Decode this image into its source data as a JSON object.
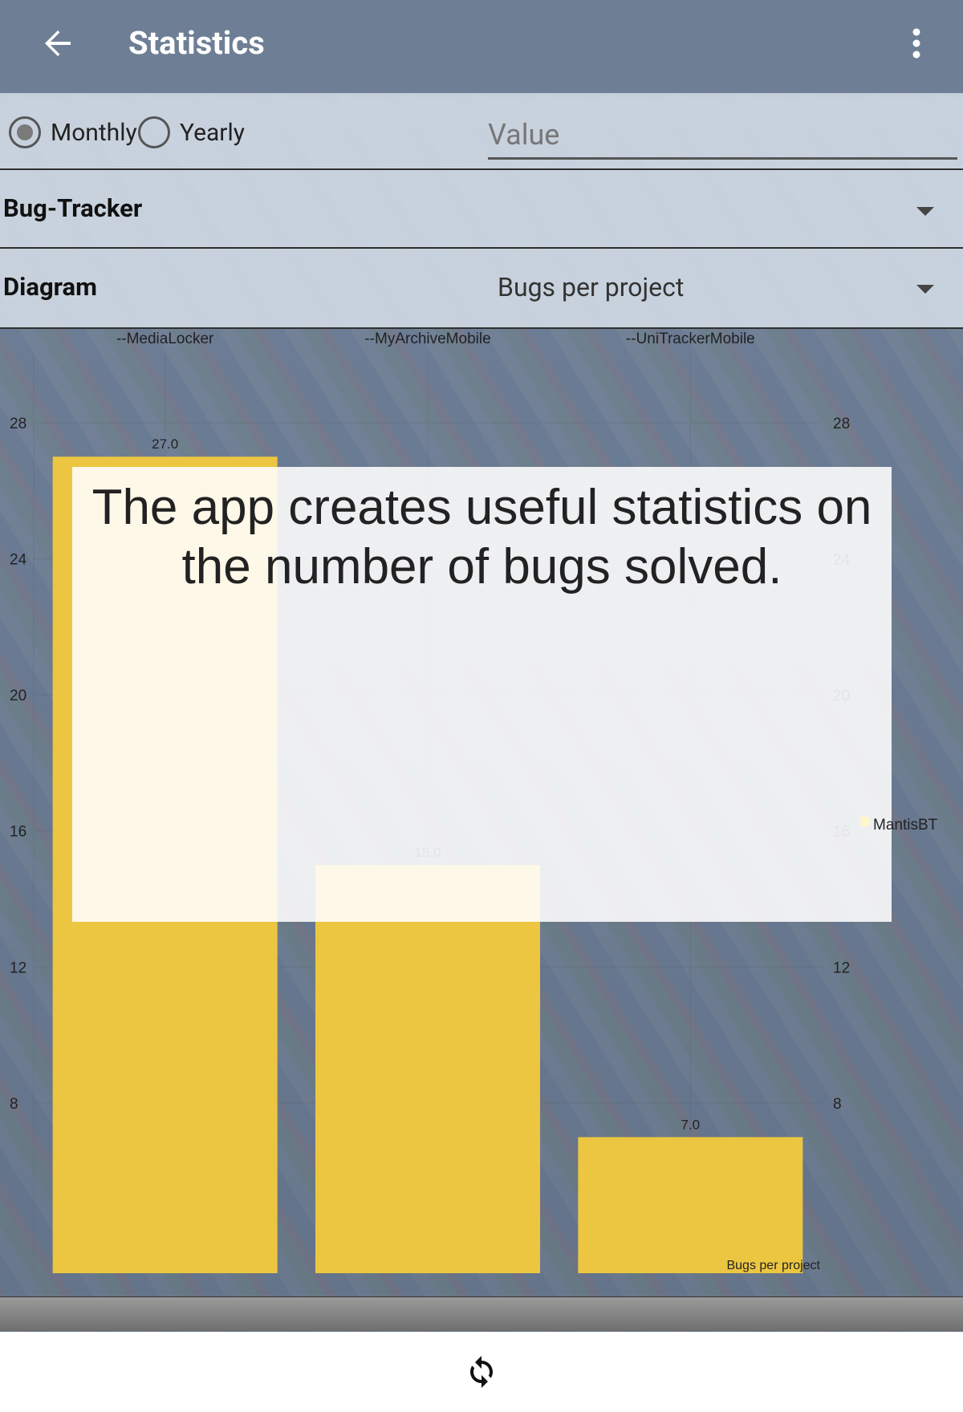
{
  "appbar": {
    "title": "Statistics",
    "back_icon": "arrow-back-icon",
    "menu_icon": "more-vert-icon"
  },
  "filters": {
    "period_options": [
      {
        "label": "Monthly",
        "selected": true
      },
      {
        "label": "Yearly",
        "selected": false
      }
    ],
    "value_placeholder": "Value"
  },
  "tracker_select": {
    "label": "Bug-Tracker",
    "value": ""
  },
  "diagram_select": {
    "label": "Diagram",
    "value": "Bugs per project"
  },
  "overlay": {
    "text": "The app creates useful statistics on the number of bugs solved."
  },
  "footer": {
    "refresh_icon": "refresh-icon"
  },
  "chart_data": {
    "type": "bar",
    "categories": [
      "--MediaLocker",
      "--MyArchiveMobile",
      "--UniTrackerMobile"
    ],
    "series": [
      {
        "name": "MantisBT",
        "values": [
          27.0,
          15.0,
          7.0
        ],
        "color": "#ecc640"
      }
    ],
    "value_labels": [
      "27.0",
      "15.0",
      "7.0"
    ],
    "ylim": [
      3,
      30
    ],
    "yticks": [
      8,
      12,
      16,
      20,
      24,
      28
    ],
    "legend_label": "MantisBT",
    "legend_position": "right",
    "description_label": "Bugs per project",
    "grid": true
  }
}
